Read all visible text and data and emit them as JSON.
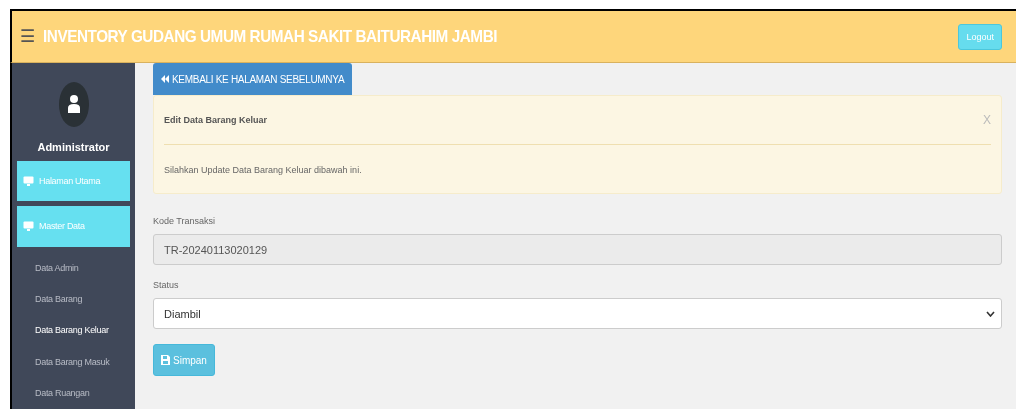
{
  "header": {
    "menu_icon": "☰",
    "title": "INVENTORY GUDANG UMUM RUMAH SAKIT BAITURAHIM JAMBI",
    "logout": "Logout"
  },
  "sidebar": {
    "user": "Administrator",
    "menu": [
      {
        "label": "Halaman Utama"
      },
      {
        "label": "Master Data"
      }
    ],
    "submenu": [
      {
        "label": "Data Admin",
        "selected": false
      },
      {
        "label": "Data Barang",
        "selected": false
      },
      {
        "label": "Data Barang Keluar",
        "selected": true
      },
      {
        "label": "Data Barang Masuk",
        "selected": false
      },
      {
        "label": "Data Ruangan",
        "selected": false
      }
    ]
  },
  "back_button": "KEMBALI KE HALAMAN SEBELUMNYA",
  "alert": {
    "title": "Edit Data Barang Keluar",
    "close": "X",
    "message": "Silahkan Update Data Barang Keluar dibawah ini."
  },
  "form": {
    "fields": [
      {
        "kind": "text",
        "label": "Kode Transaksi",
        "value": "TR-20240113020129",
        "disabled": true
      },
      {
        "kind": "select",
        "label": "Status",
        "value": "Diambil",
        "disabled": false
      }
    ],
    "submit": "Simpan"
  }
}
